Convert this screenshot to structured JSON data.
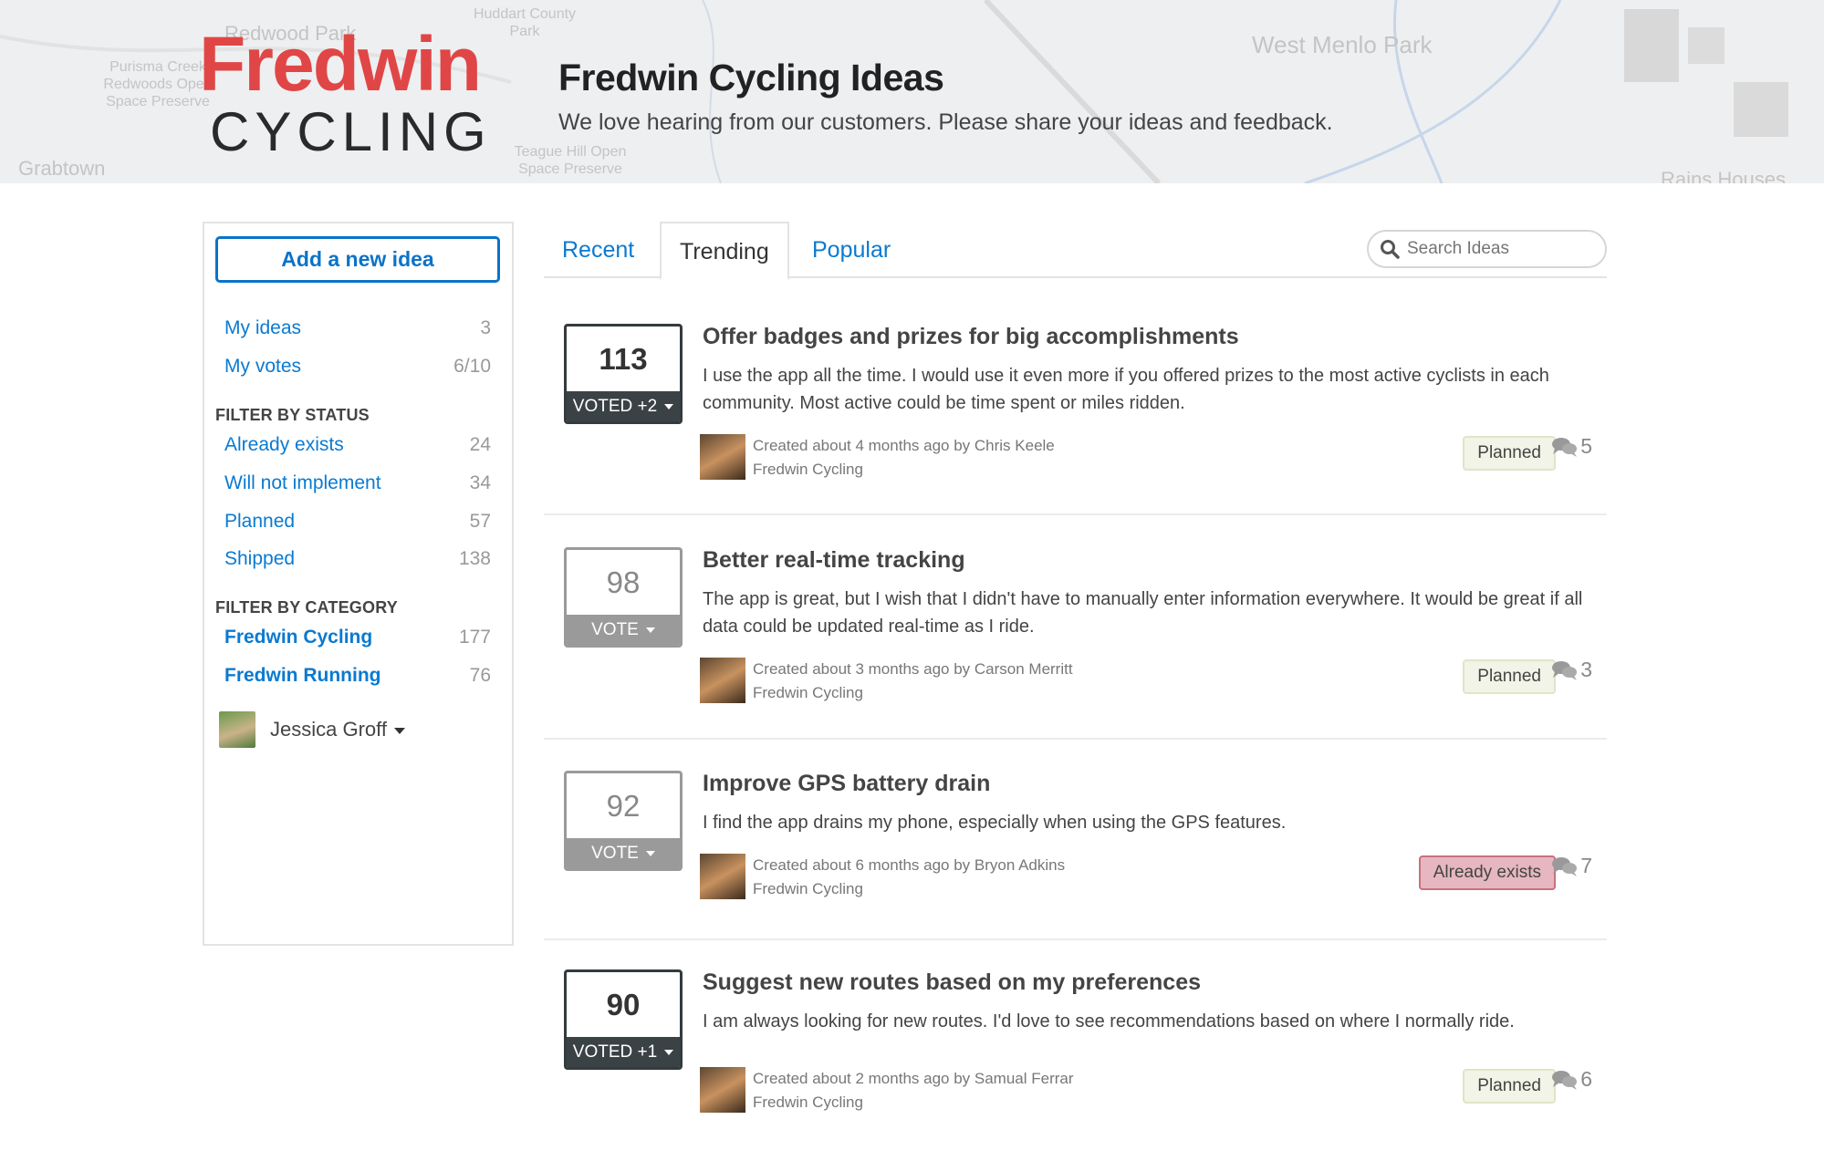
{
  "header": {
    "logo_top": "Fredwin",
    "logo_bottom": "CYCLING",
    "title": "Fredwin Cycling Ideas",
    "subtitle": "We love hearing from our customers. Please share your ideas and feedback.",
    "map_labels": [
      "Redwood Park",
      "Huddart County Park",
      "West Menlo Park",
      "Purisma Creek Redwoods Open Space Preserve",
      "Teague Hill Open Space Preserve",
      "Grabtown",
      "Rains Houses"
    ]
  },
  "sidebar": {
    "add_label": "Add a new idea",
    "my": [
      {
        "label": "My ideas",
        "count": "3"
      },
      {
        "label": "My votes",
        "count": "6/10"
      }
    ],
    "status_heading": "FILTER BY STATUS",
    "status": [
      {
        "label": "Already exists",
        "count": "24"
      },
      {
        "label": "Will not implement",
        "count": "34"
      },
      {
        "label": "Planned",
        "count": "57"
      },
      {
        "label": "Shipped",
        "count": "138"
      }
    ],
    "category_heading": "FILTER BY CATEGORY",
    "category": [
      {
        "label": "Fredwin Cycling",
        "count": "177"
      },
      {
        "label": "Fredwin Running",
        "count": "76"
      }
    ],
    "user": "Jessica Groff"
  },
  "tabs": [
    {
      "label": "Recent"
    },
    {
      "label": "Trending",
      "active": true
    },
    {
      "label": "Popular"
    }
  ],
  "search": {
    "placeholder": "Search Ideas"
  },
  "colors": {
    "brand_red": "#e04646",
    "link_blue": "#0a7ad1",
    "voted": "#3b4245",
    "unvoted": "#9a9a9a",
    "planned_bg": "#f1f4e6",
    "exists_bg": "#e6b7c0"
  },
  "ideas": [
    {
      "votes": "113",
      "vote_label": "VOTED +2",
      "voted": true,
      "title": "Offer badges and prizes for big accomplishments",
      "desc": "I use the app all the time. I would use it even more if you offered prizes to the most active cyclists in each community. Most active could be time spent or miles ridden.",
      "created": "Created about 4 months ago by Chris Keele",
      "category": "Fredwin Cycling",
      "status": "Planned",
      "comments": "5"
    },
    {
      "votes": "98",
      "vote_label": "VOTE",
      "voted": false,
      "title": "Better real-time tracking",
      "desc": "The app is great, but I wish that I didn't have to manually enter information everywhere. It would be great if all data could be updated real-time as I ride.",
      "created": "Created about 3 months ago by Carson Merritt",
      "category": "Fredwin Cycling",
      "status": "Planned",
      "comments": "3"
    },
    {
      "votes": "92",
      "vote_label": "VOTE",
      "voted": false,
      "title": "Improve GPS battery drain",
      "desc": "I find the app drains my phone, especially when using the GPS features.",
      "created": "Created about 6 months ago by Bryon Adkins",
      "category": "Fredwin Cycling",
      "status": "Already exists",
      "comments": "7"
    },
    {
      "votes": "90",
      "vote_label": "VOTED +1",
      "voted": true,
      "title": "Suggest new routes based on my preferences",
      "desc": "I am always looking for new routes. I'd love to see recommendations based on where I normally ride.",
      "created": "Created about 2 months ago by Samual Ferrar",
      "category": "Fredwin Cycling",
      "status": "Planned",
      "comments": "6"
    }
  ]
}
